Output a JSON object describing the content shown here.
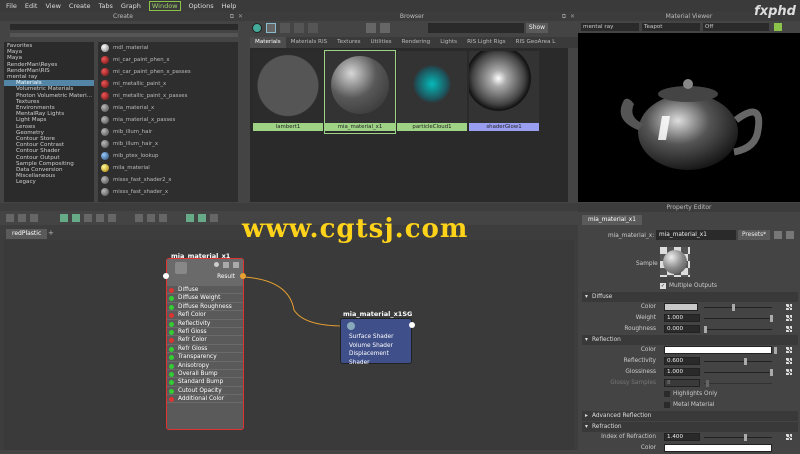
{
  "menu": [
    "File",
    "Edit",
    "View",
    "Create",
    "Tabs",
    "Graph",
    "Window",
    "Options",
    "Help"
  ],
  "watermark": {
    "brand": "fxphd",
    "site": "www.cgtsj.com"
  },
  "create": {
    "title": "Create",
    "tree": [
      "Favorites",
      "Maya",
      "Maya",
      "RenderMan\\Reyes",
      "RenderMan\\RIS",
      "mental ray",
      "Materials",
      "Volumetric Materials",
      "Photon Volumetric Materi...",
      "Textures",
      "Environments",
      "MentalRay Lights",
      "Light Maps",
      "Lenses",
      "Geometry",
      "Contour Store",
      "Contour Contrast",
      "Contour Shader",
      "Contour Output",
      "Sample Compositing",
      "Data Conversion",
      "Miscellaneous",
      "Legacy"
    ],
    "nodes": [
      "mdl_material",
      "mi_car_paint_phen_x",
      "mi_car_paint_phen_x_passes",
      "mi_metallic_paint_x",
      "mi_metallic_paint_x_passes",
      "mia_material_x",
      "mia_material_x_passes",
      "mib_illum_hair",
      "mib_illum_hair_x",
      "mib_ptex_lookup",
      "mila_material",
      "misss_fast_shader2_x",
      "misss_fast_shader_x"
    ]
  },
  "browser": {
    "title": "Browser",
    "show": "Show",
    "tabs": [
      "Materials",
      "Materials RIS",
      "Textures",
      "Utilities",
      "Rendering",
      "Lights",
      "RIS Light Rigs",
      "RIS GeoArea L"
    ],
    "swatches": [
      "lambert1",
      "mia_material_x1",
      "particleCloud1",
      "shaderGlow1"
    ]
  },
  "viewer": {
    "title": "Material Viewer",
    "renderer": "mental ray",
    "shape": "Teapot",
    "mode": "Off"
  },
  "hypershade": {
    "tab": "redPlastic",
    "tab_add": "+",
    "node1": {
      "name": "mia_material_x1",
      "result": "Result",
      "attrs": [
        "Diffuse",
        "Diffuse Weight",
        "Diffuse Roughness",
        "Refl Color",
        "Reflectivity",
        "Refl Gloss",
        "Refr Color",
        "Refr Gloss",
        "Transparency",
        "Anisotropy",
        "Overall Bump",
        "Standard Bump",
        "Cutout Opacity",
        "Additional Color"
      ]
    },
    "node2": {
      "name": "mia_material_x1SG",
      "attrs": [
        "Surface Shader",
        "Volume Shader",
        "Displacement Shader"
      ]
    }
  },
  "prop": {
    "title": "Property Editor",
    "tab": "mia_material_x1",
    "node_label": "mia_material_x:",
    "node_value": "mia_material_x1",
    "presets": "Presets*",
    "sample": "Sample",
    "multiple": "Multiple Outputs",
    "diffuse": {
      "title": "Diffuse",
      "color": "Color",
      "weight_l": "Weight",
      "weight": "1.000",
      "rough_l": "Roughness",
      "rough": "0.000"
    },
    "reflection": {
      "title": "Reflection",
      "color": "Color",
      "refl_l": "Reflectivity",
      "refl": "0.600",
      "gloss_l": "Glossiness",
      "gloss": "1.000",
      "samples_l": "Glossy Samples",
      "samples": "8",
      "hl": "Highlights Only",
      "metal": "Metal Material"
    },
    "adv": "Advanced Reflection",
    "refraction": {
      "title": "Refraction",
      "ior_l": "Index of Refraction",
      "ior": "1.400",
      "color": "Color"
    }
  }
}
